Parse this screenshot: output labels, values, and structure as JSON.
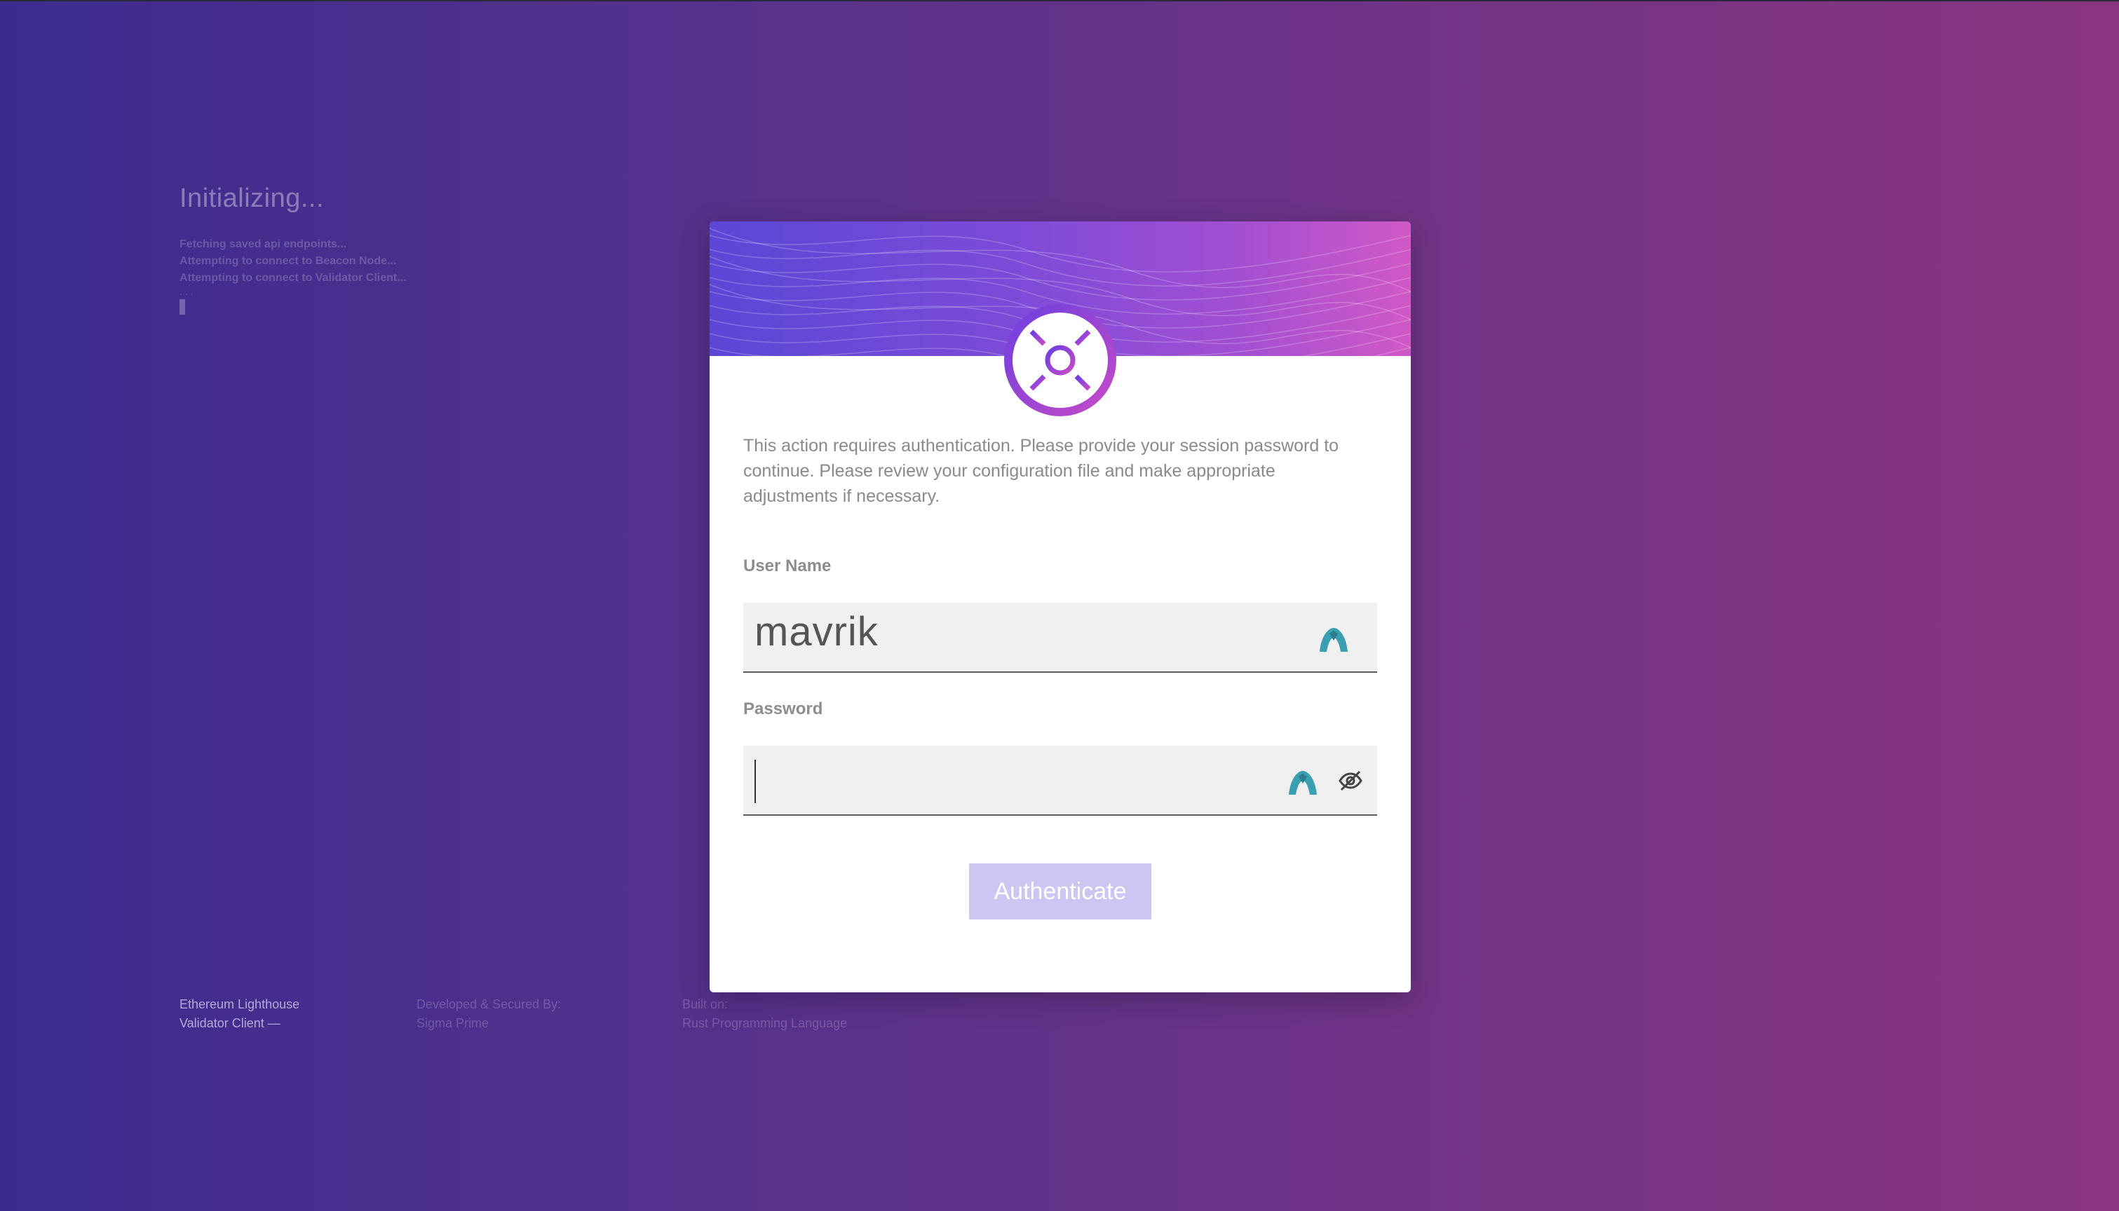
{
  "init": {
    "title": "Initializing...",
    "logs": [
      "Fetching saved api endpoints...",
      "Attempting to connect to Beacon Node...",
      "Attempting to connect to Validator Client..."
    ],
    "dots": ". . ."
  },
  "footer": {
    "col1": [
      "Ethereum Lighthouse",
      "Validator Client —"
    ],
    "col2": [
      "Developed & Secured By:",
      "Sigma Prime"
    ],
    "col3": [
      "Built on:",
      "Rust Programming Language"
    ]
  },
  "modal": {
    "description": "This action requires authentication. Please provide your session password to continue. Please review your configuration file and make appropriate adjustments if necessary.",
    "username_label": "User Name",
    "username_value": "mavrik",
    "password_label": "Password",
    "password_value": "",
    "submit_label": "Authenticate"
  },
  "colors": {
    "button_bg": "#cdc5f2",
    "accent_teal": "#3a9fb0",
    "logo_purple": "#6a3fe0",
    "logo_pink": "#c84bc7"
  },
  "icons": {
    "logo": "lighthouse-logo",
    "password_manager": "password-manager-icon",
    "visibility": "eye-off-icon"
  }
}
